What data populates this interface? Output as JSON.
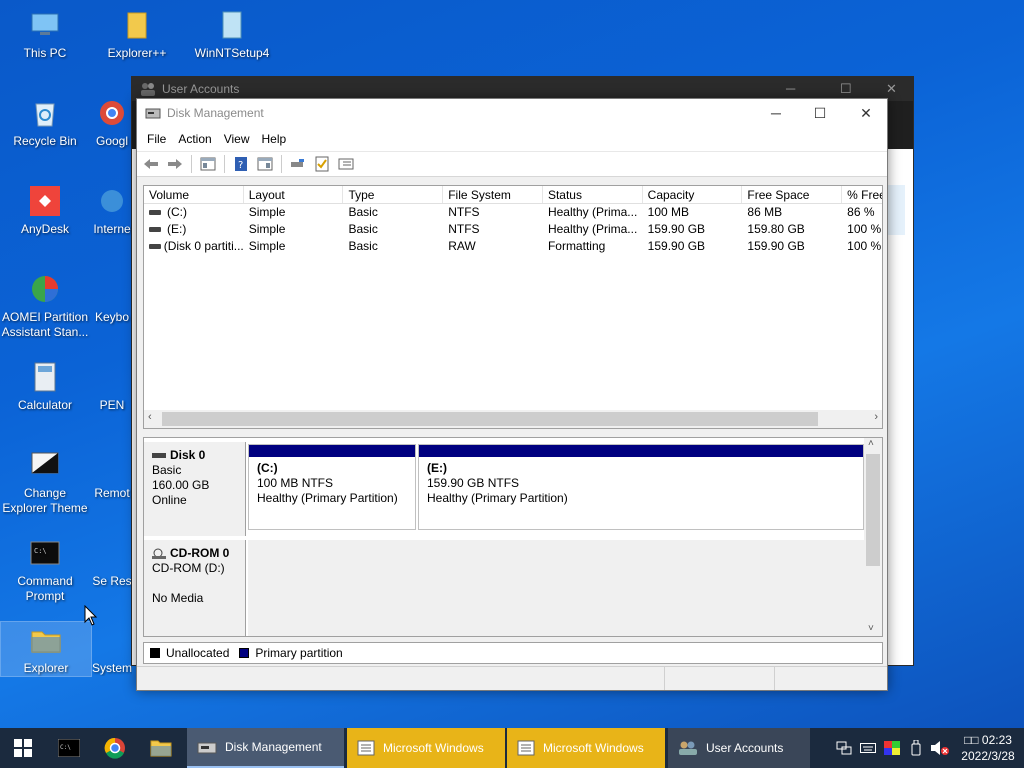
{
  "desktop": {
    "icons": [
      {
        "label": "This PC"
      },
      {
        "label": "Explorer++"
      },
      {
        "label": "WinNTSetup4"
      },
      {
        "label": "Recycle Bin"
      },
      {
        "label": "Googl"
      },
      {
        "label": "AnyDesk"
      },
      {
        "label": "Interne"
      },
      {
        "label": "AOMEI Partition Assistant Stan..."
      },
      {
        "label": "Keybo"
      },
      {
        "label": "Calculator"
      },
      {
        "label": "PEN"
      },
      {
        "label": "Change Explorer Theme"
      },
      {
        "label": "Remot"
      },
      {
        "label": "Command Prompt"
      },
      {
        "label": "Se Res"
      },
      {
        "label": "Explorer"
      },
      {
        "label": "System"
      }
    ]
  },
  "bg_window": {
    "title": "User Accounts"
  },
  "window": {
    "title": "Disk Management",
    "menu": [
      "File",
      "Action",
      "View",
      "Help"
    ]
  },
  "volume_list": {
    "columns": [
      "Volume",
      "Layout",
      "Type",
      "File System",
      "Status",
      "Capacity",
      "Free Space",
      "% Free"
    ],
    "rows": [
      {
        "volume": "(C:)",
        "layout": "Simple",
        "type": "Basic",
        "fs": "NTFS",
        "status": "Healthy (Prima...",
        "capacity": "100 MB",
        "free": "86 MB",
        "pct": "86 %"
      },
      {
        "volume": "(E:)",
        "layout": "Simple",
        "type": "Basic",
        "fs": "NTFS",
        "status": "Healthy (Prima...",
        "capacity": "159.90 GB",
        "free": "159.80 GB",
        "pct": "100 %"
      },
      {
        "volume": "(Disk 0 partiti...",
        "layout": "Simple",
        "type": "Basic",
        "fs": "RAW",
        "status": "Formatting",
        "capacity": "159.90 GB",
        "free": "159.90 GB",
        "pct": "100 %"
      }
    ]
  },
  "disks": [
    {
      "name": "Disk 0",
      "type": "Basic",
      "size": "160.00 GB",
      "state": "Online",
      "partitions": [
        {
          "name": "(C:)",
          "size_fs": "100 MB NTFS",
          "status": "Healthy (Primary Partition)"
        },
        {
          "name": "(E:)",
          "size_fs": "159.90 GB NTFS",
          "status": "Healthy (Primary Partition)"
        }
      ]
    },
    {
      "name": "CD-ROM 0",
      "type": "CD-ROM (D:)",
      "media": "No Media"
    }
  ],
  "legend": {
    "unallocated": "Unallocated",
    "primary": "Primary partition",
    "unallocated_color": "#000000",
    "primary_color": "#000080"
  },
  "taskbar": {
    "buttons": [
      {
        "label": "Disk Management"
      },
      {
        "label": "Microsoft Windows"
      },
      {
        "label": "Microsoft Windows"
      },
      {
        "label": "User Accounts"
      }
    ],
    "clock_time": "□□ 02:23",
    "clock_date": "2022/3/28"
  }
}
